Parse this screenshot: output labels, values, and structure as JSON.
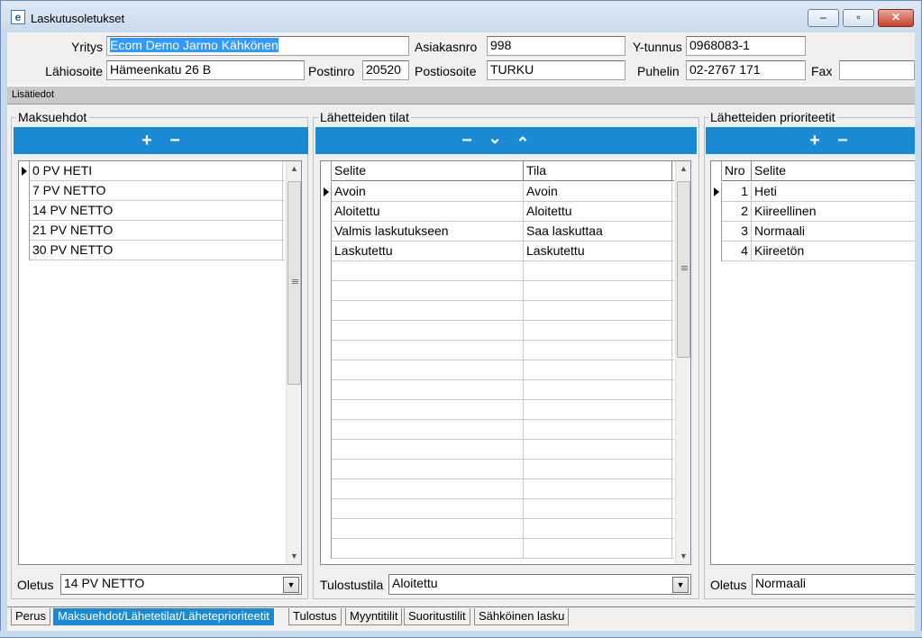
{
  "window": {
    "title": "Laskutusoletukset",
    "icon": "app-e-icon",
    "minimize": "–",
    "maximize": "▫",
    "close": "✕"
  },
  "header": {
    "yritys_label": "Yritys",
    "yritys_value": "Ecom Demo Jarmo Kähkönen",
    "asiakasnro_label": "Asiakasnro",
    "asiakasnro_value": "998",
    "ytunnus_label": "Y-tunnus",
    "ytunnus_value": "0968083-1",
    "lahiosoite_label": "Lähiosoite",
    "lahiosoite_value": "Hämeenkatu 26 B",
    "postinro_label": "Postinro",
    "postinro_value": "20520",
    "postiosoite_label": "Postiosoite",
    "postiosoite_value": "TURKU",
    "puhelin_label": "Puhelin",
    "puhelin_value": "02-2767 171",
    "fax_label": "Fax",
    "fax_value": ""
  },
  "info_bar": {
    "label": "Lisätiedot"
  },
  "maksuehdot": {
    "title": "Maksuehdot",
    "toolbar": {
      "add": "+",
      "remove": "−"
    },
    "rows": [
      "0 PV HETI",
      "7 PV NETTO",
      "14 PV NETTO",
      "21 PV NETTO",
      "30 PV NETTO"
    ],
    "oletus_label": "Oletus",
    "oletus_value": "14 PV NETTO"
  },
  "lahetteiden_tilat": {
    "title": "Lähetteiden tilat",
    "toolbar": {
      "remove": "−",
      "down": "⌄",
      "up": "⌃"
    },
    "columns": [
      "Selite",
      "Tila"
    ],
    "rows": [
      [
        "Avoin",
        "Avoin"
      ],
      [
        "Aloitettu",
        "Aloitettu"
      ],
      [
        "Valmis laskutukseen",
        "Saa laskuttaa"
      ],
      [
        "Laskutettu",
        "Laskutettu"
      ]
    ],
    "tulostustila_label": "Tulostustila",
    "tulostustila_value": "Aloitettu"
  },
  "lahetteiden_prioriteetit": {
    "title": "Lähetteiden prioriteetit",
    "toolbar": {
      "add": "+",
      "remove": "−"
    },
    "columns": [
      "Nro",
      "Selite"
    ],
    "rows": [
      [
        "1",
        "Heti"
      ],
      [
        "2",
        "Kiireellinen"
      ],
      [
        "3",
        "Normaali"
      ],
      [
        "4",
        "Kiireetön"
      ]
    ],
    "oletus_label": "Oletus",
    "oletus_value": "Normaali"
  },
  "tabs": [
    "Perus",
    "Maksuehdot/Lähetetilat/Läheteprioriteetit",
    "Tulostus",
    "Myyntitilit",
    "Suoritustilit",
    "Sähköinen lasku"
  ],
  "colors": {
    "accent": "#1a8ad4",
    "selection": "#3399ff"
  }
}
